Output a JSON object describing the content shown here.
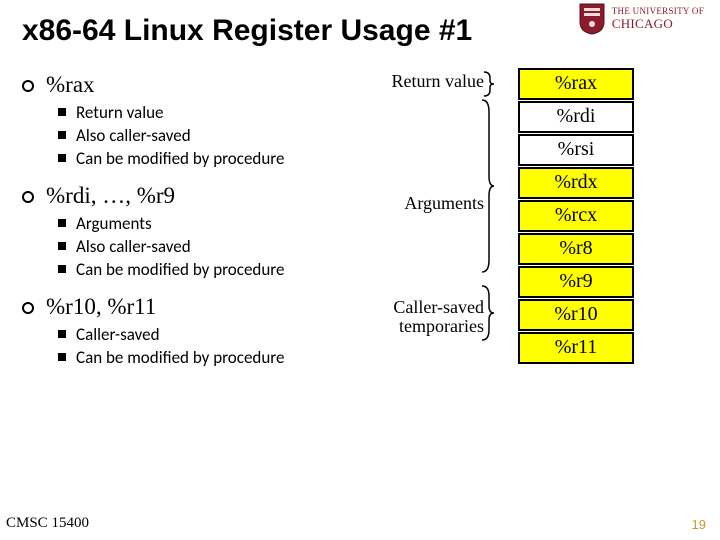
{
  "logo": {
    "line1": "THE UNIVERSITY OF",
    "line2": "CHICAGO"
  },
  "title": "x86-64 Linux Register Usage #1",
  "sections": [
    {
      "title": "%rax",
      "items": [
        "Return value",
        "Also caller-saved",
        "Can be modified by procedure"
      ]
    },
    {
      "title": "%rdi, …, %r9",
      "items": [
        "Arguments",
        "Also caller-saved",
        "Can be modified by procedure"
      ]
    },
    {
      "title": "%r10, %r11",
      "items": [
        "Caller-saved",
        "Can be modified by procedure"
      ]
    }
  ],
  "mid_labels": {
    "return": "Return value",
    "args": "Arguments",
    "temps_l1": "Caller-saved",
    "temps_l2": "temporaries"
  },
  "registers": {
    "group_return": [
      "%rax"
    ],
    "group_args": [
      "%rdi",
      "%rsi",
      "%rdx",
      "%rcx",
      "%r8",
      "%r9"
    ],
    "group_temps": [
      "%r10",
      "%r11"
    ]
  },
  "footer": {
    "course": "CMSC 15400",
    "page": "19"
  }
}
